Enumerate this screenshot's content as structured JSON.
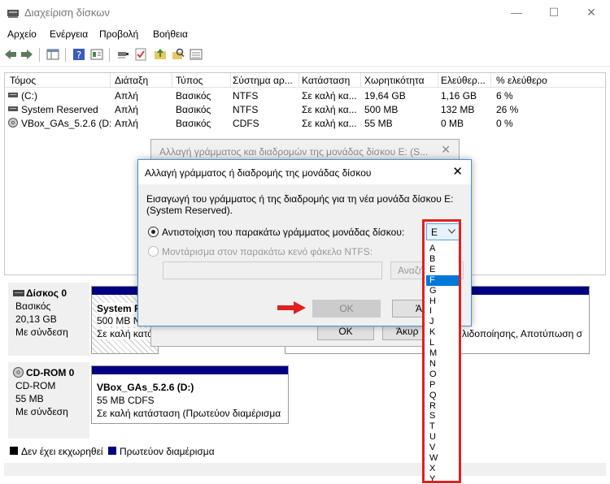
{
  "window": {
    "title": "Διαχείριση δίσκων",
    "minimize": "—",
    "maximize": "☐",
    "close": "✕"
  },
  "menu": [
    "Αρχείο",
    "Ενέργεια",
    "Προβολή",
    "Βοήθεια"
  ],
  "columns": [
    "Τόμος",
    "Διάταξη",
    "Τύπος",
    "Σύστημα αρ...",
    "Κατάσταση",
    "Χωρητικότητα",
    "Ελεύθερ...",
    "% ελεύθερο"
  ],
  "volumes": [
    {
      "name": "(C:)",
      "layout": "Απλή",
      "type": "Βασικός",
      "fs": "NTFS",
      "status": "Σε καλή κα...",
      "capacity": "19,64 GB",
      "free": "1,16 GB",
      "pct": "6 %",
      "icon": "drive-icon"
    },
    {
      "name": "System Reserved",
      "layout": "Απλή",
      "type": "Βασικός",
      "fs": "NTFS",
      "status": "Σε καλή κα...",
      "capacity": "500 MB",
      "free": "132 MB",
      "pct": "26 %",
      "icon": "drive-icon"
    },
    {
      "name": "VBox_GAs_5.2.6 (D:)",
      "layout": "Απλή",
      "type": "Βασικός",
      "fs": "CDFS",
      "status": "Σε καλή κα...",
      "capacity": "55 MB",
      "free": "0 MB",
      "pct": "0 %",
      "icon": "cd-icon"
    }
  ],
  "disks": [
    {
      "name": "Δίσκος 0",
      "kind": "Βασικός",
      "size": "20,13 GB",
      "state": "Με σύνδεση",
      "partitions": [
        {
          "line1": "System R",
          "line2": "500 MB N",
          "line3": "Σε καλή κατά"
        },
        {
          "line1": "",
          "line2": "",
          "line3": "λιδοποίησης, Αποτύπωση σ"
        }
      ]
    },
    {
      "name": "CD-ROM 0",
      "kind": "CD-ROM",
      "size": "55 MB",
      "state": "Με σύνδεση",
      "partitions": [
        {
          "line1": "VBox_GAs_5.2.6  (D:)",
          "line2": "55 MB CDFS",
          "line3": "Σε καλή κατάσταση (Πρωτεύον διαμέρισμα"
        }
      ]
    }
  ],
  "legend": [
    {
      "label": "Δεν έχει εκχωρηθεί",
      "color": "#000000"
    },
    {
      "label": "Πρωτεύον διαμέρισμα",
      "color": "#000080"
    }
  ],
  "dialog_back": {
    "title": "Αλλαγή γράμματος και διαδρομών της μονάδας δίσκου E: (S...",
    "ok": "OK",
    "cancel": "Άκυρ",
    "close": "✕"
  },
  "dialog_front": {
    "title": "Αλλαγή γράμματος ή διαδρομής της μονάδας δίσκου",
    "close": "✕",
    "description": "Εισαγωγή του γράμματος ή της διαδρομής για τη νέα μονάδα δίσκου E: (System Reserved).",
    "option_letter": "Αντιστοίχιση του παρακάτω γράμματος μονάδας δίσκου:",
    "option_folder": "Μοντάρισμα στον παρακάτω κενό φάκελο NTFS:",
    "folder_path": "",
    "browse": "Αναζή",
    "ok": "OK",
    "cancel": "Άκ"
  },
  "dropdown": {
    "selected": "E",
    "highlighted": "F",
    "options": [
      "A",
      "B",
      "E",
      "F",
      "G",
      "H",
      "I",
      "J",
      "K",
      "L",
      "M",
      "N",
      "O",
      "P",
      "Q",
      "R",
      "S",
      "T",
      "U",
      "V",
      "W",
      "X",
      "Y"
    ]
  },
  "colors": {
    "accent": "#0078d7",
    "highlight_border": "#e02020",
    "partition_bar": "#000080",
    "arrow": "#e02020"
  }
}
